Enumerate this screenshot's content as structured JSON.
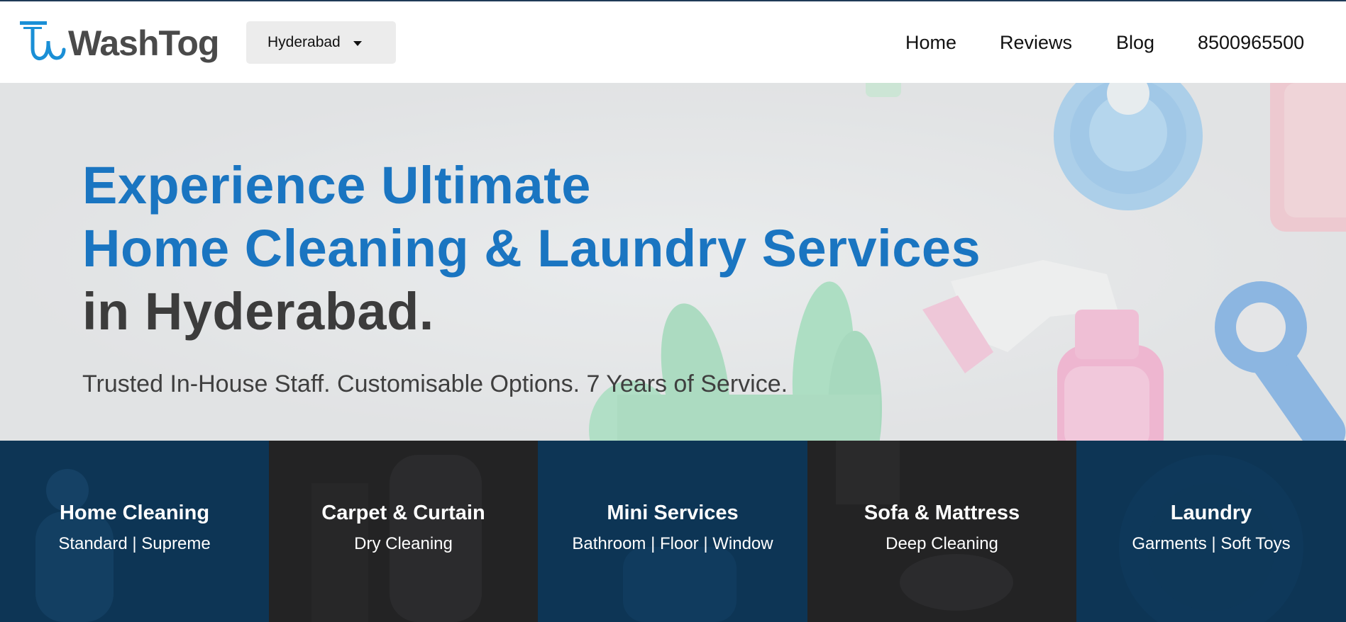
{
  "header": {
    "logo_text": "WashTog",
    "city": "Hyderabad",
    "nav": {
      "home": "Home",
      "reviews": "Reviews",
      "blog": "Blog",
      "phone": "8500965500"
    }
  },
  "hero": {
    "title_line1": "Experience Ultimate",
    "title_line2": "Home Cleaning & Laundry Services",
    "title_line3": "in Hyderabad.",
    "subtitle": "Trusted In-House Staff. Customisable Options. 7 Years of Service."
  },
  "services": [
    {
      "title": "Home Cleaning",
      "subtitle": "Standard | Supreme",
      "color": "#0d3555"
    },
    {
      "title": "Carpet & Curtain",
      "subtitle": "Dry Cleaning",
      "color": "#232324"
    },
    {
      "title": "Mini Services",
      "subtitle": "Bathroom | Floor | Window",
      "color": "#0d3555"
    },
    {
      "title": "Sofa & Mattress",
      "subtitle": "Deep Cleaning",
      "color": "#232324"
    },
    {
      "title": "Laundry",
      "subtitle": "Garments | Soft Toys",
      "color": "#0d3555"
    }
  ],
  "colors": {
    "brand_blue": "#1a75c1",
    "hero_dark_text": "#3c3c3c",
    "tile_navy": "#0d3555",
    "tile_charcoal": "#232324"
  }
}
